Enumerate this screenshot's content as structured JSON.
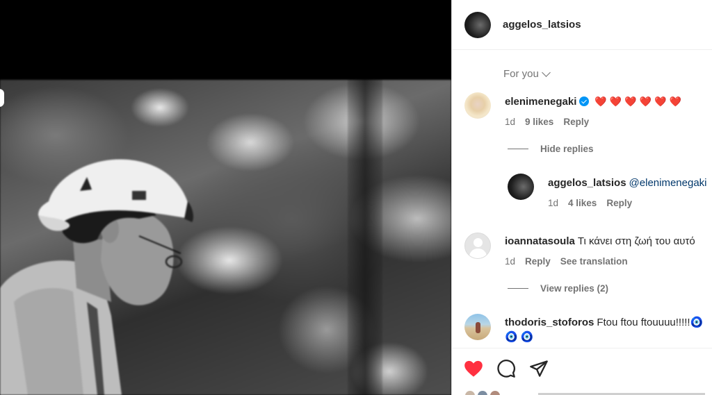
{
  "post": {
    "author": "aggelos_latsios"
  },
  "comments_sort": {
    "label": "For you"
  },
  "comments": [
    {
      "username": "elenimenegaki",
      "text": "❤️❤️❤️❤️❤️❤️",
      "time": "1d",
      "likes": "9 likes",
      "reply_label": "Reply",
      "replies_toggle": "Hide replies",
      "replies": [
        {
          "username": "aggelos_latsios",
          "text": "@elenimenegaki",
          "time": "1d",
          "likes": "4 likes",
          "reply_label": "Reply"
        }
      ]
    },
    {
      "username": "ioannatasoula",
      "text": "Τι κάνει στη ζωή του αυτό",
      "time": "1d",
      "reply_label": "Reply",
      "translate_label": "See translation",
      "replies_toggle": "View replies (2)"
    },
    {
      "username": "thodoris_stoforos",
      "text": "Ftou ftou ftouuuu!!!!!",
      "text_emoji": "🧿",
      "second_line": "🧿🧿"
    }
  ],
  "icons": {
    "like": "heart-icon",
    "comment": "comment-icon",
    "share": "share-icon"
  },
  "colors": {
    "like_red": "#ff3040",
    "link_blue": "#00376b",
    "verified_blue": "#0095f6",
    "muted_text": "#737373"
  }
}
